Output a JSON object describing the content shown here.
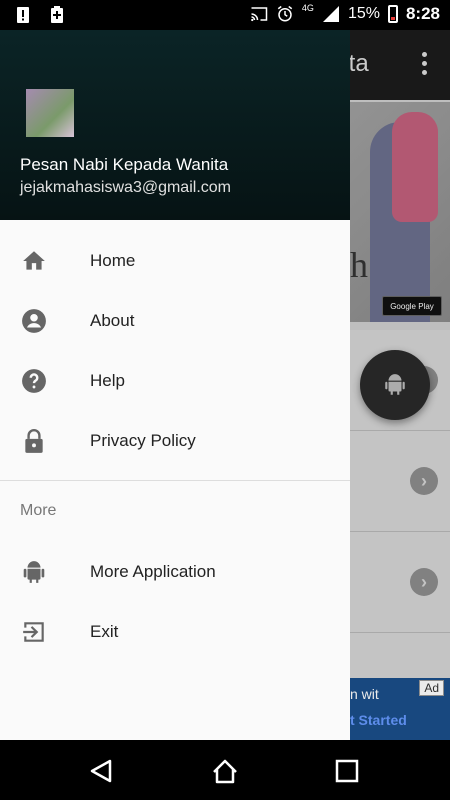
{
  "status_bar": {
    "signal_label": "4G",
    "battery_percent": "15%",
    "time": "8:28",
    "icons": [
      "alert-icon",
      "battery-charging-icon",
      "cast-icon",
      "alarm-icon",
      "signal-icon",
      "battery-icon"
    ]
  },
  "app": {
    "title_fragment": "nita",
    "banner_text_fragment": "h",
    "play_badge": "Google Play",
    "ad": {
      "line1": "n wit",
      "line2": "t Started",
      "badge": "Ad"
    }
  },
  "drawer": {
    "header": {
      "name": "Pesan Nabi Kepada Wanita",
      "email": "jejakmahasiswa3@gmail.com"
    },
    "items": [
      {
        "label": "Home",
        "icon": "home-icon"
      },
      {
        "label": "About",
        "icon": "account-circle-icon"
      },
      {
        "label": "Help",
        "icon": "help-icon"
      },
      {
        "label": "Privacy Policy",
        "icon": "lock-icon"
      }
    ],
    "section_label": "More",
    "more_items": [
      {
        "label": "More Application",
        "icon": "android-icon"
      },
      {
        "label": "Exit",
        "icon": "exit-icon"
      }
    ]
  },
  "colors": {
    "header_bg": "#0b2426",
    "drawer_bg": "#fafafa",
    "icon_color": "#666666"
  }
}
